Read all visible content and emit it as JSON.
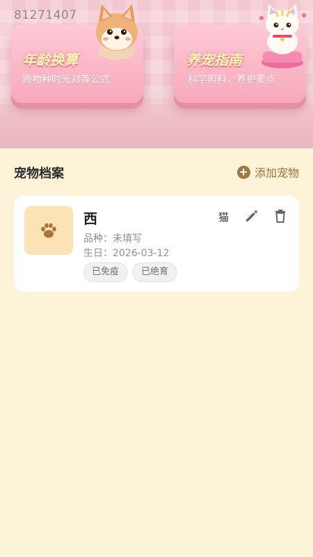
{
  "banner": {
    "app_id": "81271407",
    "cards": [
      {
        "title": "年龄换算",
        "subtitle": "跨物种时光对等公式"
      },
      {
        "title": "养宠指南",
        "subtitle": "科学照料，养护要点"
      }
    ]
  },
  "section": {
    "title": "宠物档案",
    "add_label": "添加宠物"
  },
  "pet": {
    "name": "西",
    "type": "猫",
    "breed_label": "品种：",
    "breed_value": "未填写",
    "birthday_label": "生日：",
    "birthday_value": "2026-03-12",
    "tags": [
      "已免疫",
      "已绝育"
    ]
  },
  "colors": {
    "background": "#fdf3d8",
    "accent": "#9a7436",
    "card_pink": "#f7a9bb",
    "avatar_bg": "#fbe3b6"
  },
  "icons": [
    "paw-icon",
    "edit-icon",
    "delete-icon",
    "add-icon"
  ]
}
